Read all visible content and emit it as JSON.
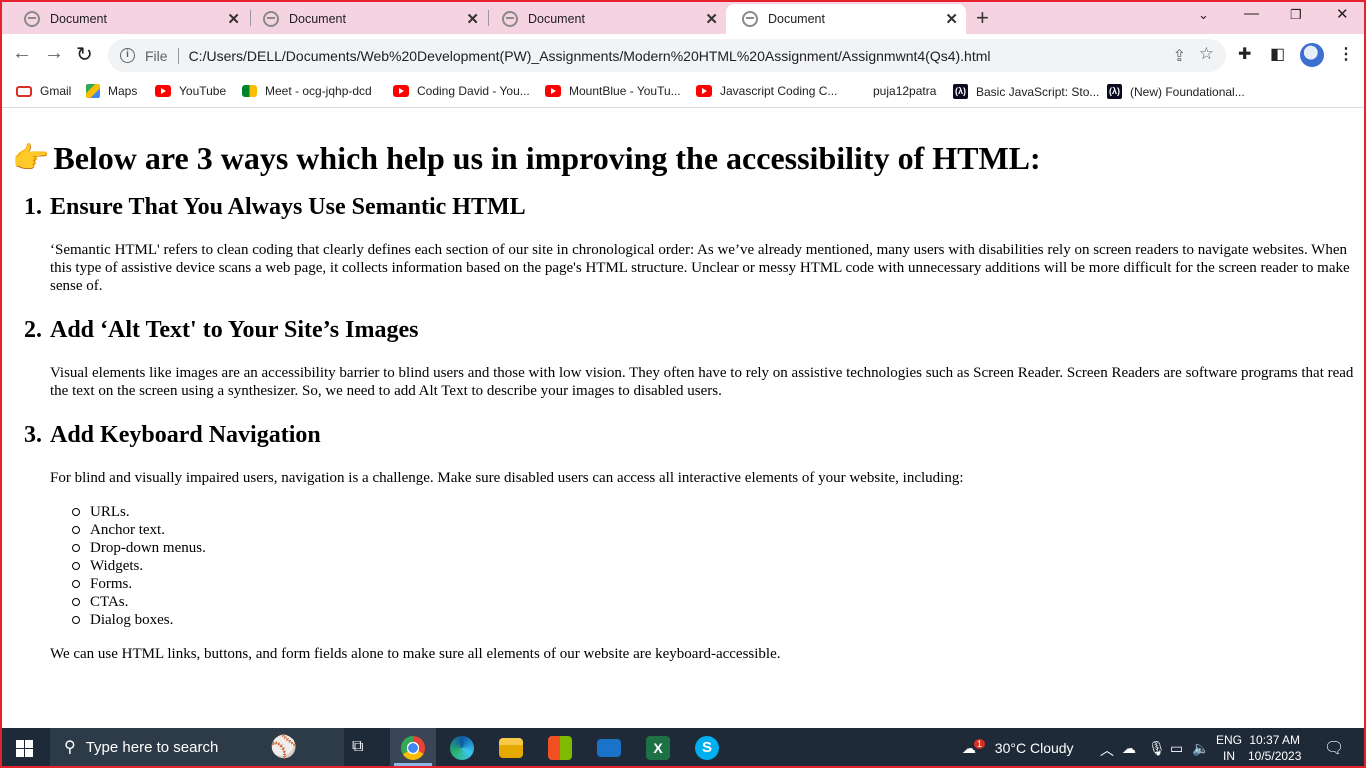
{
  "browser": {
    "tabs": [
      {
        "title": "Document",
        "active": false
      },
      {
        "title": "Document",
        "active": false
      },
      {
        "title": "Document",
        "active": false
      },
      {
        "title": "Document",
        "active": true
      }
    ],
    "address": {
      "scheme_label": "File",
      "url": "C:/Users/DELL/Documents/Web%20Development(PW)_Assignments/Modern%20HTML%20Assignment/Assignmwnt4(Qs4).html"
    },
    "bookmarks": [
      {
        "label": "Gmail",
        "icon": "gmail-icon"
      },
      {
        "label": "Maps",
        "icon": "maps-icon"
      },
      {
        "label": "YouTube",
        "icon": "youtube-icon"
      },
      {
        "label": "Meet - ocg-jqhp-dcd",
        "icon": "meet-icon"
      },
      {
        "label": "Coding David - You...",
        "icon": "youtube-icon"
      },
      {
        "label": "MountBlue - YouTu...",
        "icon": "youtube-icon"
      },
      {
        "label": "Javascript Coding C...",
        "icon": "youtube-icon"
      },
      {
        "label": "puja12patra",
        "icon": "none"
      },
      {
        "label": "Basic JavaScript: Sto...",
        "icon": "freecodecamp-icon"
      },
      {
        "label": "(New) Foundational...",
        "icon": "freecodecamp-icon"
      }
    ]
  },
  "page": {
    "heading": "Below are 3 ways which help us in improving the accessibility of HTML:",
    "sections": [
      {
        "number": "1.",
        "title": "Ensure That You Always Use Semantic HTML",
        "body": "‘Semantic HTML' refers to clean coding that clearly defines each section of our site in chronological order: As we’ve already mentioned, many users with disabilities rely on screen readers to navigate websites. When this type of assistive device scans a web page, it collects information based on the page's HTML structure. Unclear or messy HTML code with unnecessary additions will be more difficult for the screen reader to make sense of."
      },
      {
        "number": "2.",
        "title": "Add ‘Alt Text' to Your Site’s Images",
        "body": "Visual elements like images are an accessibility barrier to blind users and those with low vision. They often have to rely on assistive technologies such as Screen Reader. Screen Readers are software programs that read the text on the screen using a synthesizer. So, we need to add Alt Text to describe your images to disabled users."
      },
      {
        "number": "3.",
        "title": "Add Keyboard Navigation",
        "body": "For blind and visually impaired users, navigation is a challenge. Make sure disabled users can access all interactive elements of your website, including:",
        "items": [
          "URLs.",
          "Anchor text.",
          "Drop-down menus.",
          "Widgets.",
          "Forms.",
          "CTAs.",
          "Dialog boxes."
        ],
        "footer": "We can use HTML links, buttons, and form fields alone to make sure all elements of our website are keyboard-accessible."
      }
    ]
  },
  "taskbar": {
    "search_placeholder": "Type here to search",
    "weather": "30°C  Cloudy",
    "weather_badge": "1",
    "lang_top": "ENG",
    "lang_bottom": "IN",
    "time": "10:37 AM",
    "date": "10/5/2023"
  },
  "colors": {
    "frame": "#e5232e",
    "tabstrip": "#f6d3e0",
    "taskbar": "#1e2a38"
  }
}
